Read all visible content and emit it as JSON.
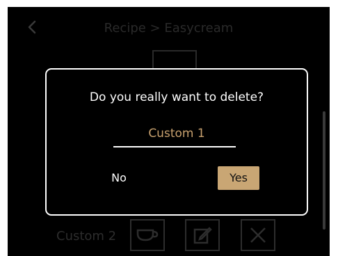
{
  "header": {
    "title": "Recipe > Easycream",
    "back_icon": "chevron-left-icon"
  },
  "list": {
    "row_label": "Custom 2",
    "row_icons": [
      "cup-icon",
      "edit-icon",
      "close-icon"
    ]
  },
  "dialog": {
    "question": "Do you really want to delete?",
    "item_name": "Custom 1",
    "no_label": "No",
    "yes_label": "Yes"
  },
  "colors": {
    "accent": "#c9a674",
    "item_text": "#c9a26f",
    "background": "#000000",
    "dimmed": "#2a2a2a"
  }
}
